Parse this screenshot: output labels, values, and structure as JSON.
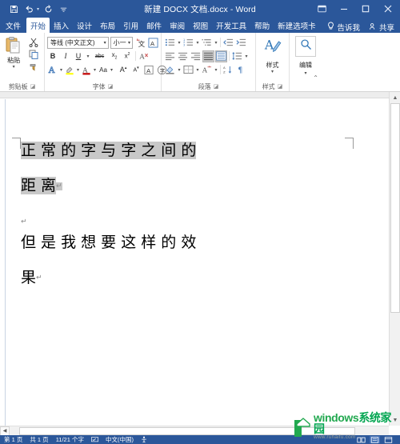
{
  "titlebar": {
    "document_title": "新建 DOCX 文档.docx  -  Word",
    "qat": [
      {
        "name": "save-icon",
        "label": "保存"
      },
      {
        "name": "undo-icon",
        "label": "撤消"
      },
      {
        "name": "redo-icon",
        "label": "恢复"
      },
      {
        "name": "customize-qat-icon",
        "label": "自定义快速访问工具栏"
      }
    ],
    "ribbon_display_options": "功能区显示选项",
    "minimize": "最小化",
    "maximize": "最大化",
    "close": "关闭",
    "accent_color": "#2b579a"
  },
  "tabs": [
    {
      "label": "文件",
      "active": false
    },
    {
      "label": "开始",
      "active": true
    },
    {
      "label": "插入",
      "active": false
    },
    {
      "label": "设计",
      "active": false
    },
    {
      "label": "布局",
      "active": false
    },
    {
      "label": "引用",
      "active": false
    },
    {
      "label": "邮件",
      "active": false
    },
    {
      "label": "审阅",
      "active": false
    },
    {
      "label": "视图",
      "active": false
    },
    {
      "label": "开发工具",
      "active": false
    },
    {
      "label": "帮助",
      "active": false
    },
    {
      "label": "新建选项卡",
      "active": false
    }
  ],
  "tabs_right": {
    "tell_me": "告诉我",
    "tell_me_icon": "lightbulb-icon",
    "share": "共享",
    "share_icon": "person-share-icon"
  },
  "ribbon": {
    "clipboard": {
      "group_label": "剪贴板",
      "paste_label": "粘贴",
      "cut_label": "剪切",
      "copy_label": "复制",
      "format_painter_label": "格式刷"
    },
    "font": {
      "group_label": "字体",
      "font_name": "等线 (中文正文)",
      "font_size": "小一",
      "bold": "B",
      "italic": "I",
      "underline": "U",
      "strikethrough": "abc",
      "subscript": "x₂",
      "superscript": "x²",
      "text_effects_label": "文本效果和版式",
      "highlight_label": "以不同颜色突出显示文本",
      "font_color_label": "字体颜色",
      "change_case": "Aa",
      "grow_font": "A",
      "shrink_font": "A",
      "phonetic_guide_label": "拼音指南",
      "char_border_label": "字符边框",
      "clear_format_label": "清除所有格式"
    },
    "paragraph": {
      "group_label": "段落",
      "bullets_label": "项目符号",
      "numbering_label": "编号",
      "multilevel_label": "多级列表",
      "decrease_indent_label": "减少缩进量",
      "increase_indent_label": "增加缩进量",
      "align_left_label": "左对齐",
      "align_center_label": "居中",
      "align_right_label": "右对齐",
      "justify_label": "两端对齐",
      "distribute_label": "分散对齐",
      "line_spacing_label": "行和段落间距",
      "shading_label": "底纹",
      "borders_label": "边框",
      "asian_layout_label": "中文版式",
      "sort_label": "排序",
      "show_marks_label": "显示/隐藏编辑标记"
    },
    "styles": {
      "group_label": "样式",
      "button_label": "样式"
    },
    "editing": {
      "group_label": "编辑",
      "button_label": "编辑",
      "icon": "magnifier-icon"
    },
    "collapse_ribbon_icon": "chevron-up-icon"
  },
  "document": {
    "paragraphs": [
      {
        "id": "p1",
        "selected": true,
        "lines": [
          "正 常 的 字 与 字 之 间 的",
          "距 离"
        ],
        "end_mark": "↵"
      },
      {
        "id": "p2-blank",
        "selected": false,
        "lines": [
          ""
        ],
        "end_mark": "↵"
      },
      {
        "id": "p3",
        "selected": false,
        "lines": [
          "但 是 我 想 要 这 样 的 效",
          "果"
        ],
        "end_mark": "↵"
      }
    ],
    "selection_color": "#c8c8c8"
  },
  "statusbar": {
    "page_info": "第 1 页",
    "page_total": "共 1 页",
    "word_count": "11/21 个字",
    "proofing_icon": "spellcheck-icon",
    "language": "中文(中国)",
    "accessibility_icon": "accessibility-icon",
    "view_buttons": [
      {
        "name": "read-mode",
        "icon": "read-mode-icon",
        "active": false
      },
      {
        "name": "print-layout",
        "icon": "print-layout-icon",
        "active": true
      },
      {
        "name": "web-layout",
        "icon": "web-layout-icon",
        "active": false
      }
    ]
  },
  "watermark": {
    "brand": "windows",
    "brand_cn": "系统家园",
    "url": "www.ruhaifu.com",
    "color": "#21a84f"
  }
}
